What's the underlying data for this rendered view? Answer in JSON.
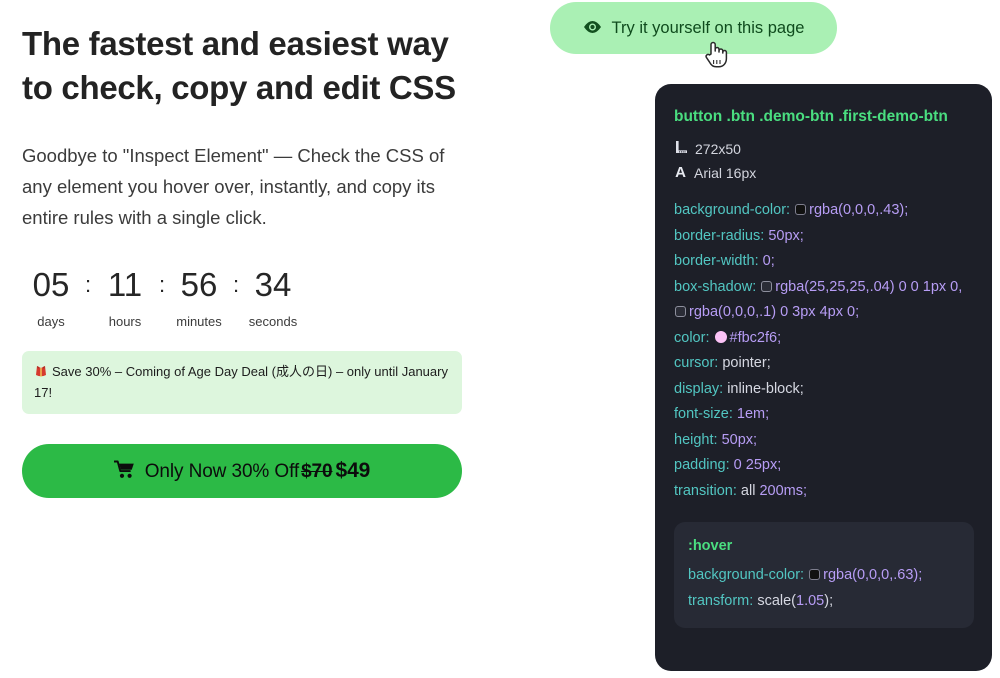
{
  "hero": {
    "headline": "The fastest and easiest way to check, copy and edit CSS",
    "subcopy": "Goodbye to \"Inspect Element\" — Check the CSS of any element you hover over, instantly, and copy its entire rules with a single click."
  },
  "countdown": {
    "units": [
      {
        "value": "05",
        "label": "days"
      },
      {
        "value": "11",
        "label": "hours"
      },
      {
        "value": "56",
        "label": "minutes"
      },
      {
        "value": "34",
        "label": "seconds"
      }
    ],
    "separator": ":"
  },
  "promo": {
    "emoji_name": "kimono-emoji",
    "text": "Save 30% – Coming of Age Day Deal (成人の日) – only until January 17!",
    "background": "#ddf6dd"
  },
  "cta": {
    "icon_name": "shopping-cart-icon",
    "label": "Only Now 30% Off",
    "old_price": "$70",
    "new_price": "$49",
    "background": "#2cba46"
  },
  "try_pill": {
    "icon_name": "eye-icon",
    "label": "Try it yourself on this page",
    "background": "#aaf0b4",
    "text_color": "#0f4b1d"
  },
  "cursor": {
    "icon_name": "pointing-hand-cursor"
  },
  "inspector": {
    "background": "#1d1f28",
    "selector": {
      "tag": "button",
      "classes": ".btn .demo-btn .first-demo-btn",
      "color": "#4ade80"
    },
    "dimensions": {
      "icon_name": "ruler-icon",
      "text": "272x50"
    },
    "font": {
      "icon_name": "font-letter-a-icon",
      "text": "Arial 16px"
    },
    "properties": [
      {
        "name": "background-color",
        "swatch": "dark",
        "value": "rgba(0,0,0,.43)",
        "kind": "value"
      },
      {
        "name": "border-radius",
        "value": "50px",
        "kind": "value"
      },
      {
        "name": "border-width",
        "value": "0",
        "kind": "value"
      },
      {
        "name": "box-shadow",
        "swatch": "light",
        "value": "rgba(25,25,25,.04) 0 0 1px 0,",
        "swatch2": "light",
        "value2": "rgba(0,0,0,.1) 0 3px 4px 0",
        "kind": "value"
      },
      {
        "name": "color",
        "swatch": "pink",
        "value": "#fbc2f6",
        "kind": "value"
      },
      {
        "name": "cursor",
        "value": "pointer",
        "kind": "keyword"
      },
      {
        "name": "display",
        "value": "inline-block",
        "kind": "keyword"
      },
      {
        "name": "font-size",
        "value": "1em",
        "kind": "value"
      },
      {
        "name": "height",
        "value": "50px",
        "kind": "value"
      },
      {
        "name": "padding",
        "value": "0 25px",
        "kind": "value"
      },
      {
        "name": "transition",
        "value_kw": "all ",
        "value": "200ms",
        "kind": "mixed"
      }
    ],
    "hover_block": {
      "title": ":hover",
      "background": "#272a35",
      "properties": [
        {
          "name": "background-color",
          "swatch": "dark",
          "value": "rgba(0,0,0,.63)"
        },
        {
          "name": "transform",
          "value_kw": "scale(",
          "value": "1.05",
          "value_tail": ")"
        }
      ]
    },
    "semicolon": ";"
  }
}
